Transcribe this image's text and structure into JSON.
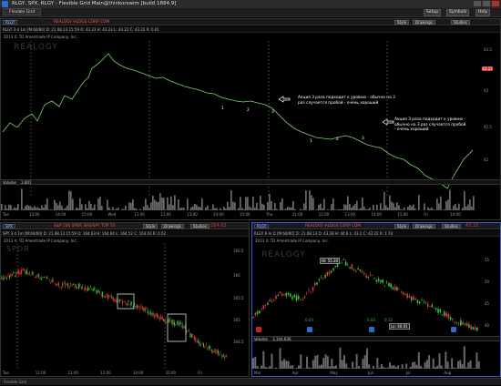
{
  "window": {
    "title": "RLGY, SPX, RLGY - Flexible Grid Main@thinkorswim [build 1884.9]",
    "tab": "Flexible Grid"
  },
  "toolbar": {
    "setup": "Setup",
    "symbols": "Symbols",
    "help": "Help"
  },
  "top_chart": {
    "symbol": "RLGY",
    "news": "REALOGY HLDGS CORP COM",
    "quote": "RLGY 3 d 1m [M:60/60]  D: 21.08.13 15:59  O: 43.23  H: 43.23  L: 43.22  C: 43.22  R: 0.01",
    "style": "Style",
    "drawings": "Drawings",
    "studies": "Studies",
    "copyright": "2013 © TD Ameritrade IP Company, Inc.",
    "watermark": "REALOGY",
    "price_tag": "43.22",
    "y_ticks": [
      "43.5",
      "43",
      "42.5",
      "42"
    ],
    "x_ticks": [
      "Tue",
      "13:00",
      "14:00",
      "15:00",
      "Wed",
      "11:00",
      "12:00",
      "13:00",
      "14:00",
      "15:00",
      "Thu",
      "11:00",
      "12:00",
      "13:00",
      "14:00",
      "15:00",
      "Fri",
      "10:00"
    ],
    "touches": [
      "1",
      "2",
      "3",
      "1",
      "2",
      "3"
    ],
    "annotation1": "Акция 3 раза подходит к уровню - обычно на 3\nраз случается пробой - очень хороший",
    "annotation2": "Акция 3 раза подходит к уровню -\nобычно на 3 раз случается пробой\n- очень хороший",
    "volume_label": "Volume",
    "volume_value": "2,801"
  },
  "bottom_left": {
    "symbol": "SPX",
    "news": "S&P 500 SPDR SHS/SPY  TOP 50",
    "quote": "SPY 3 d 1m [M:60/60]  D: 21.08.13 15:59  O: 164.03  H: 164.04  L: 164.52  C: 164.03  R: 0.02",
    "style": "Style",
    "drawings": "Drawings",
    "studies": "Studies",
    "price_tag": "164.82",
    "copyright": "2013 © TD Ameritrade IP Company, Inc.",
    "watermark": "SPDR",
    "y_ticks": [
      "166.5",
      "166",
      "165.5",
      "165",
      "164.5"
    ],
    "x_ticks": [
      "Tue",
      "11:00",
      "12:00",
      "13:00",
      "14:00",
      "15:00",
      "Fri"
    ]
  },
  "bottom_right": {
    "symbol": "RLGY",
    "news": "REALOGY HLDGS CORP COM",
    "quote": "RLGY 6 m D [M:60/60]  D: 21.08.13  O: 43.28  H: 44.6  L: 43.2  C: 43.22  R: 1.74",
    "style": "Style",
    "drawings": "Drawings",
    "studies": "Studies",
    "price_tag": "43.22",
    "copyright": "2013 © TD Ameritrade IP Company, Inc.",
    "watermark": "REALOGY",
    "hi_label": "Hi: 55.20",
    "lo_label": "Lo: 40.01",
    "vals": [
      "0.03",
      "0.03",
      "0.12"
    ],
    "volume_label": "Volume",
    "volume_value": "3,104,836",
    "y_ticks": [
      "55",
      "50",
      "45",
      "40"
    ],
    "x_ticks": [
      "Mar",
      "Apr",
      "May",
      "Jun",
      "Jul",
      "Aug"
    ]
  },
  "status": "Flexible Grid",
  "colors": {
    "accent": "#e03030",
    "candle_up": "#3fbf3f",
    "candle_down": "#e03a3a",
    "price_line": "#7fd26b"
  }
}
